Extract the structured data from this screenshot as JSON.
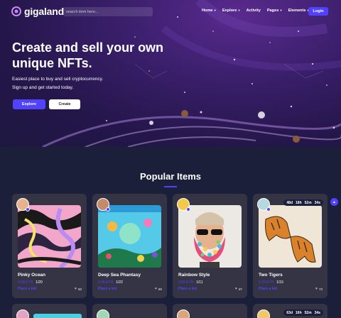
{
  "brand": {
    "name": "gigaland"
  },
  "search": {
    "placeholder": "search item here..."
  },
  "nav": {
    "items": [
      "Home",
      "Explore",
      "Activity",
      "Pages",
      "Elements"
    ],
    "login": "Login"
  },
  "hero": {
    "title_line1": "Create and sell your own",
    "title_line2": "unique NFTs.",
    "sub_line1": "Easiest place to buy and sell cryptocurrency.",
    "sub_line2": "Sign up and get started today.",
    "explore": "Explore",
    "create": "Create"
  },
  "popular": {
    "title": "Popular Items",
    "cards": [
      {
        "name": "Pinky Ocean",
        "price": "0.08 ETH",
        "edition": "1/20",
        "bid": "Place a bid",
        "likes": "50"
      },
      {
        "name": "Deep Sea Phantasy",
        "price": "0.06 ETH",
        "edition": "1/22",
        "bid": "Place a bid",
        "likes": "80"
      },
      {
        "name": "Rainbow Style",
        "price": "0.05 ETH",
        "edition": "1/11",
        "bid": "Place a bid",
        "likes": "97"
      },
      {
        "name": "Two Tigers",
        "price": "0.02 ETH",
        "edition": "1/15",
        "bid": "Place a bid",
        "likes": "73",
        "timer": [
          "48d",
          "18h",
          "52m",
          "34s"
        ]
      }
    ],
    "row2_timer": [
      "63d",
      "16h",
      "52m",
      "34s"
    ]
  },
  "colors": {
    "accent": "#5142fc",
    "card_bg": "#343444",
    "page_bg": "#1b1f3a"
  }
}
